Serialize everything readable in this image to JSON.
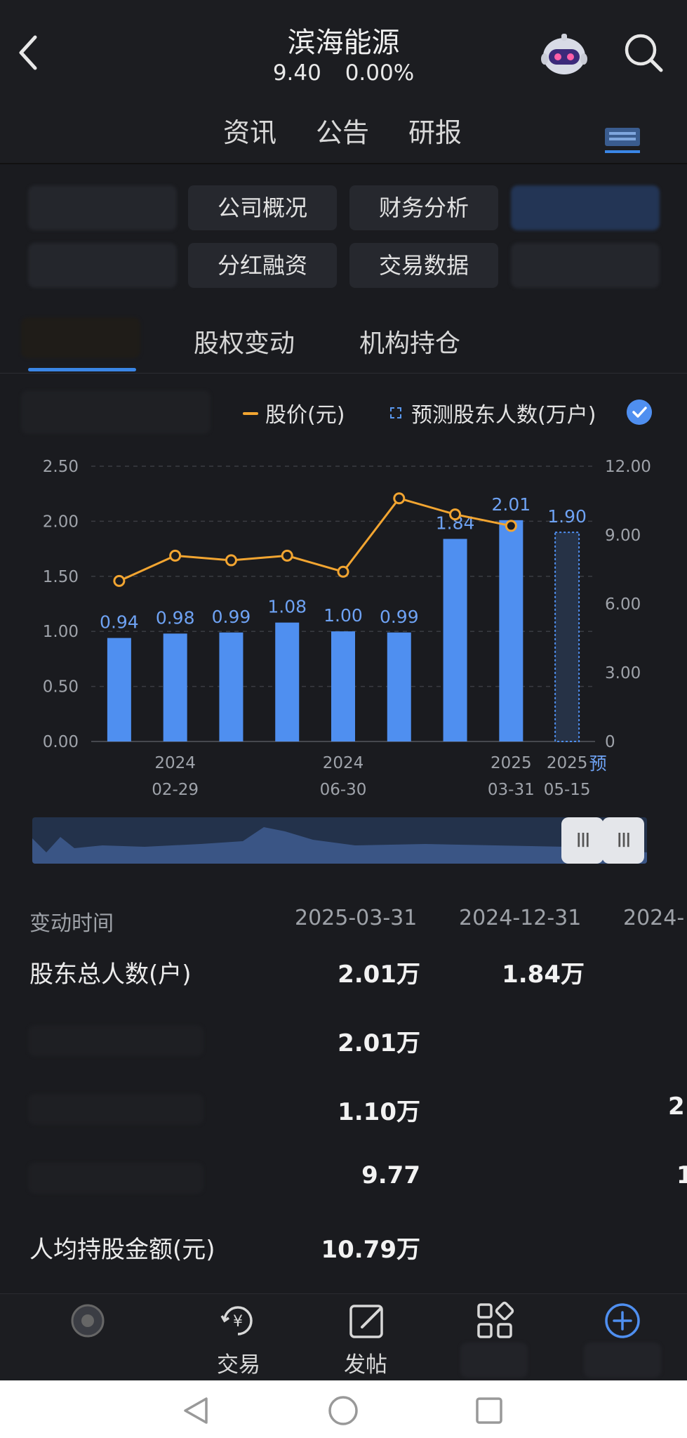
{
  "header": {
    "title": "滨海能源",
    "price": "9.40",
    "change": "0.00%"
  },
  "top_tabs": [
    "资讯",
    "公告",
    "研报"
  ],
  "grid_buttons": {
    "company_overview": "公司概况",
    "financial_analysis": "财务分析",
    "dividend_financing": "分红融资",
    "trading_data": "交易数据"
  },
  "sub_tabs": [
    "股权变动",
    "机构持仓"
  ],
  "legend": {
    "price": "股价(元)",
    "forecast": "预测股东人数(万户)"
  },
  "chart_data": {
    "type": "bar",
    "categories": [
      "",
      "2024\n02-29",
      "",
      "",
      "2024\n06-30",
      "",
      "",
      "2025\n03-31",
      "2025\n05-15"
    ],
    "series": [
      {
        "name": "预测股东人数(万户)",
        "values": [
          0.94,
          0.98,
          0.99,
          1.08,
          1.0,
          0.99,
          1.84,
          2.01,
          1.9
        ],
        "axis": "left",
        "style": "bar",
        "color": "#4f8ff0",
        "last_forecast": true
      },
      {
        "name": "股价(元)",
        "values": [
          7.0,
          8.1,
          7.9,
          8.1,
          7.4,
          10.6,
          9.9,
          9.4
        ],
        "axis": "right",
        "style": "line",
        "color": "#f2a531"
      }
    ],
    "bar_labels": [
      "0.94",
      "0.98",
      "0.99",
      "1.08",
      "1.00",
      "0.99",
      "1.84",
      "2.01",
      "1.90"
    ],
    "x_tick_labels": [
      {
        "year": "2024",
        "date": "02-29"
      },
      {
        "year": "2024",
        "date": "06-30"
      },
      {
        "year": "2025",
        "date": "03-31"
      },
      {
        "year": "2025",
        "date": "05-15"
      }
    ],
    "forecast_marker": "预",
    "y_left_ticks": [
      "2.50",
      "2.00",
      "1.50",
      "1.00",
      "0.50",
      "0.00"
    ],
    "y_right_ticks": [
      "12.00",
      "9.00",
      "6.00",
      "3.00",
      "0"
    ],
    "ylim_left": [
      0,
      2.5
    ],
    "ylim_right": [
      0,
      12
    ],
    "grid": true,
    "legend_position": "top-right"
  },
  "table": {
    "header_label": "变动时间",
    "columns": [
      "2025-03-31",
      "2024-12-31",
      "2024-"
    ],
    "rows": [
      {
        "label": "股东总人数(户)",
        "values": [
          "2.01万",
          "1.84万",
          ""
        ]
      },
      {
        "label": "",
        "values": [
          "2.01万",
          "",
          ""
        ]
      },
      {
        "label": "",
        "values": [
          "1.10万",
          "",
          "2."
        ]
      },
      {
        "label": "",
        "values": [
          "9.77",
          "",
          "1"
        ]
      },
      {
        "label": "人均持股金额(元)",
        "values": [
          "10.79万",
          "",
          ""
        ]
      }
    ]
  },
  "bottom_nav": [
    "交易",
    "发帖"
  ]
}
